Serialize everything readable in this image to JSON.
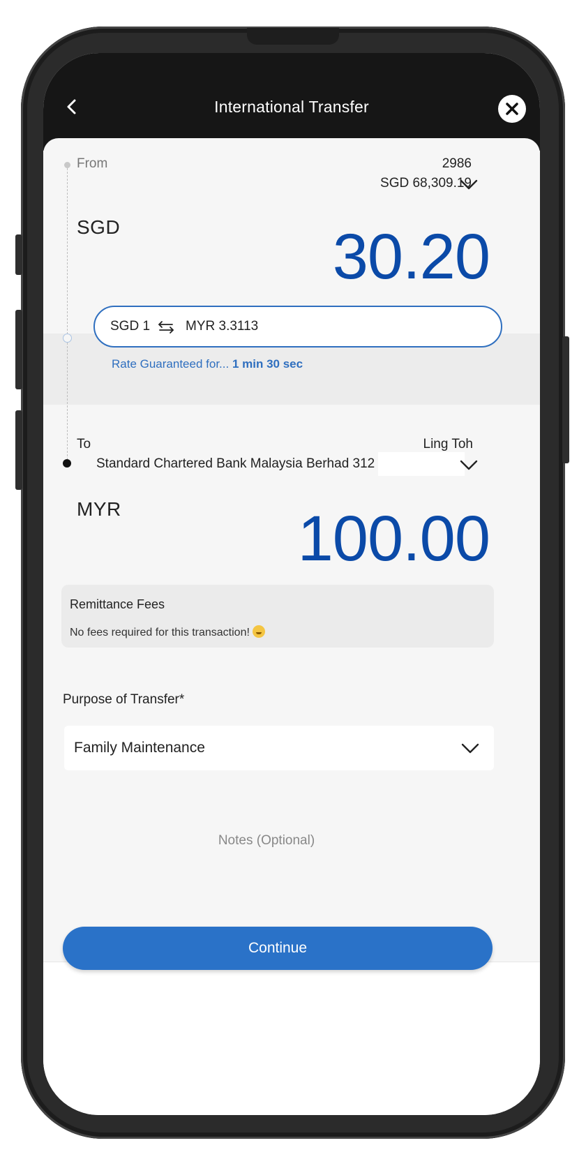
{
  "header": {
    "title": "International Transfer"
  },
  "from": {
    "label": "From",
    "account_number": "2986",
    "balance": "SGD 68,309.19",
    "currency": "SGD",
    "amount": "30.20"
  },
  "rate": {
    "from": "SGD 1",
    "to": "MYR 3.3113",
    "note_prefix": "Rate Guaranteed for...",
    "note_time": "1 min 30 sec"
  },
  "to": {
    "label": "To",
    "name": "Ling Toh",
    "bank": "Standard Chartered Bank Malaysia Berhad 312",
    "currency": "MYR",
    "amount": "100.00"
  },
  "fees": {
    "title": "Remittance Fees",
    "text": "No fees required for this transaction!"
  },
  "purpose": {
    "label": "Purpose of Transfer*",
    "value": "Family Maintenance"
  },
  "notes": {
    "placeholder": "Notes (Optional)"
  },
  "footer": {
    "continue_label": "Continue"
  },
  "colors": {
    "accent": "#2a72c8",
    "amount": "#0b4aa8",
    "header_bg": "#161616"
  }
}
